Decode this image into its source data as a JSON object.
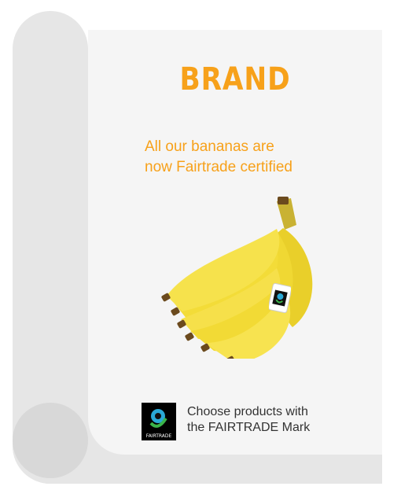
{
  "brand": {
    "name": "BRAND"
  },
  "tagline": {
    "line1": "All our bananas are",
    "line2": "now Fairtrade certified"
  },
  "logo": {
    "label": "FAIRTRADE"
  },
  "footer": {
    "line1": "Choose products with",
    "line2": "the FAIRTRADE Mark"
  },
  "colors": {
    "accent": "#f7a11a",
    "banana": "#f6df3b",
    "card": "#f5f5f5",
    "scroll": "#e6e6e6"
  },
  "icons": {
    "main_image": "banana-bunch-icon",
    "sticker": "fairtrade-sticker-icon",
    "mark": "fairtrade-mark-icon"
  }
}
